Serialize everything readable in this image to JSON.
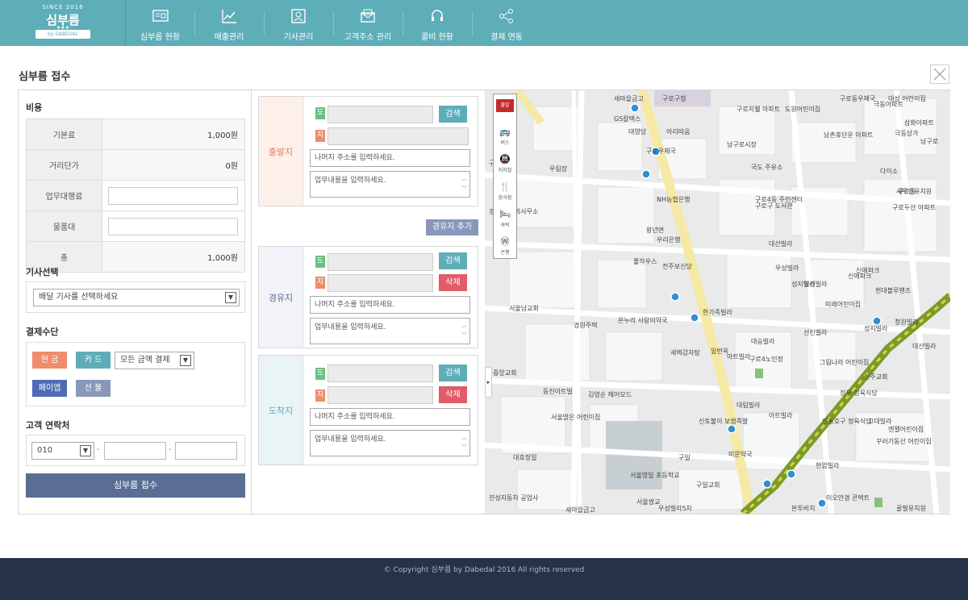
{
  "brand": {
    "since": "SINCE 2016",
    "name": "심부름",
    "ribbon": "by DABEDAL"
  },
  "nav": [
    {
      "label": "심부름 현황",
      "icon": "monitor-list-icon"
    },
    {
      "label": "매출관리",
      "icon": "chart-icon"
    },
    {
      "label": "기사관리",
      "icon": "id-card-icon"
    },
    {
      "label": "고객주소 관리",
      "icon": "mail-icon"
    },
    {
      "label": "콜비 현황",
      "icon": "headset-icon"
    },
    {
      "label": "결제 연동",
      "icon": "share-icon"
    }
  ],
  "page_title": "심부름 접수",
  "cost": {
    "section": "비용",
    "rows": [
      {
        "label": "기본료",
        "value": "1,000원"
      },
      {
        "label": "거리단가",
        "value": "0원"
      },
      {
        "label": "업무대행료",
        "value": ""
      },
      {
        "label": "물품대",
        "value": ""
      },
      {
        "label": "총",
        "value": "1,000원"
      }
    ]
  },
  "driver": {
    "section": "기사선택",
    "select_value": "배달 기사를 선택하세요"
  },
  "payment": {
    "section": "결제수단",
    "cash": "현 금",
    "card": "카 드",
    "card_select": "모든 금액 결제",
    "payapp": "페이앱",
    "prepaid": "선 불"
  },
  "contact": {
    "section": "고객 연락처",
    "prefix": "010",
    "dash": "-"
  },
  "submit_label": "심부름 접수",
  "route": {
    "tag_do": "도",
    "tag_ji": "지",
    "search": "검색",
    "delete": "삭제",
    "addr_placeholder": "나머지 주소를 입력하세요.",
    "work_placeholder": "업무내용을 입력하세요.",
    "add_stop": "경유지 추가",
    "origin": "출발지",
    "waypoint": "경유지",
    "destination": "도착지"
  },
  "map": {
    "tools": [
      {
        "label": "출발",
        "icon": "flag-icon"
      },
      {
        "label": "버스",
        "icon": "bus-icon"
      },
      {
        "label": "지하철",
        "icon": "subway-icon"
      },
      {
        "label": "음식점",
        "icon": "restaurant-icon"
      },
      {
        "label": "숙박",
        "icon": "bed-icon"
      },
      {
        "label": "은행",
        "icon": "bank-icon"
      }
    ],
    "labels": [
      "GS칼텍스",
      "대영당",
      "아리따움",
      "구로지웰 아파트",
      "도원어린이집",
      "극동아파트",
      "극동상가",
      "남촌휴단운 아파트",
      "다이소",
      "구로동",
      "구로우체국",
      "남구로시장",
      "NH농협은행",
      "왕년면",
      "우리은행",
      "구로4동 주민센터",
      "구로구 도서관",
      "대산빌라",
      "우성빌라",
      "성지빌라",
      "풀하우스",
      "전주보신당",
      "영진빌라",
      "미래어린이집",
      "신애파크",
      "현대블루핸즈",
      "청원빌라",
      "대산빌라",
      "서울남교회",
      "경원주택",
      "온누리 사랑의약국",
      "한가족빌라",
      "대승빌라",
      "선진빌라",
      "아트빌라",
      "새벽감자탕",
      "일번옥",
      "구로4노인정",
      "그림나라 어린이집",
      "동진아트빌",
      "김영순 헤어모드",
      "서울밝은 어린이집",
      "대림빌라",
      "아트빌라",
      "신토불이 보쌈족발",
      "인홍호구 정육식당",
      "고대빌라",
      "엔젤어린이집",
      "꾸러기동산 어린이집",
      "대호정밀",
      "서울영일 초등학교",
      "구일교회",
      "미문약국",
      "현암빌라",
      "이오안경 콘택트",
      "경성세무 회사무소",
      "우림장",
      "남구로",
      "성지빌라",
      "신애파크",
      "구로두산 아파트",
      "새두산유치원",
      "꿀벌유치원",
      "서울쌍교",
      "구일",
      "진성자동차 공업사",
      "새마을금고",
      "우성빌라5차",
      "공영",
      "본투비치",
      "구로동1대",
      "중앙교회",
      "신주교회",
      "새마을금고",
      "구로동우체국",
      "대성 어린이집",
      "삼화아파트",
      "구로구청",
      "정우 정육식당",
      "국도 주유소"
    ]
  },
  "footer": "© Copyright 심부름 by Dabedal 2016 All rights reserved"
}
